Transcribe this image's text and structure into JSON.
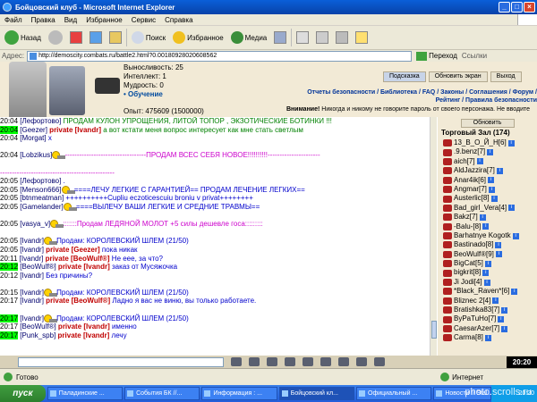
{
  "window": {
    "title": "Бойцовский клуб - Microsoft Internet Explorer"
  },
  "menu": [
    "Файл",
    "Правка",
    "Вид",
    "Избранное",
    "Сервис",
    "Справка"
  ],
  "toolbar": {
    "back": "Назад",
    "search": "Поиск",
    "favorites": "Избранное",
    "media": "Медиа"
  },
  "address": {
    "label": "Адрес:",
    "url": "http://demoscity.combats.ru/battle2.html?0.00180928020608562",
    "go": "Переход",
    "links": "Ссылки"
  },
  "character": {
    "stats": [
      "Выносливость: 25",
      "Интеллект: 1",
      "Мудрость: 0"
    ],
    "training": "• Обучение",
    "exp": "Опыт: 475609 (1500000)"
  },
  "topbuttons": {
    "hint": "Подсказка",
    "refresh": "Обновить экран",
    "exit": "Выход"
  },
  "toplinks": "Отчеты безопасности / Библиотека / FAQ / Законы / Соглашения / Форум / Рейтинг / Правила безопасности",
  "warning": {
    "bold": "Внимание!",
    "text": " Никогда и никому не говорите пароль от своего персонажа. Не вводите"
  },
  "chat": [
    {
      "time": "20:04",
      "hl": false,
      "nick": "[Лефортово]",
      "parts": [
        {
          "c": "green",
          "t": " ПРОДАМ КУЛОН УПРОЩЕНИЯ, ЛИТОЙ ТОПОР , ЭКЗОТИЧЕСКИЕ БОТИНКИ !!!"
        }
      ]
    },
    {
      "time": "20:04",
      "hl": true,
      "nick": "[Geezer]",
      "priv": true,
      "to": "[Ivandr]",
      "parts": [
        {
          "c": "green",
          "t": " а вот кстати меня вопрос интересует как мне стать светлым"
        }
      ]
    },
    {
      "time": "20:04",
      "hl": false,
      "nick": "[Morgat]",
      "parts": [
        {
          "c": "blue",
          "t": " x"
        }
      ]
    },
    {
      "blank": true
    },
    {
      "time": "20:04",
      "hl": false,
      "nick": "[Lobzikus]",
      "smiley": true,
      "parts": [
        {
          "c": "magenta",
          "t": " ----------------------------------ПРОДАМ ВСЕС СЕБЯ НОВОЕ!!!!!!!!!!----------------------"
        }
      ]
    },
    {
      "blank": true
    },
    {
      "time": "",
      "hl": false,
      "nick": "",
      "parts": [
        {
          "c": "magenta",
          "t": "   ------------------------------------------------"
        }
      ]
    },
    {
      "time": "20:05",
      "hl": false,
      "nick": "[Лефортово]",
      "parts": [
        {
          "c": "blue",
          "t": " ."
        }
      ]
    },
    {
      "time": "20:05",
      "hl": false,
      "nick": "[Menson666]",
      "smiley": true,
      "parts": [
        {
          "c": "blue",
          "t": " ====ЛЕЧУ ЛЕГКИЕ С ГАРАНТИЕЙ== ПРОДАМ ЛЕЧЕНИЕ ЛЕГКИХ=="
        }
      ]
    },
    {
      "time": "20:05",
      "hl": false,
      "nick": "[btnmeatman]",
      "parts": [
        {
          "c": "blue",
          "t": " ++++++++++Cupliu eczoticescuiu broniu v privat++++++++"
        }
      ]
    },
    {
      "time": "20:05",
      "hl": false,
      "nick": "[Gamelander]",
      "smiley": true,
      "parts": [
        {
          "c": "blue",
          "t": " ====ВЫЛЕЧУ ВАШИ ЛЕГКИЕ И СРЕДНИЕ ТРАВМЫ=="
        }
      ]
    },
    {
      "blank": true
    },
    {
      "time": "20:05",
      "hl": false,
      "nick": "[vasya_v]",
      "smiley": true,
      "parts": [
        {
          "c": "magenta",
          "t": " :::::::Продам ЛЕДЯНОЙ МОЛОТ +5 силы дешевле госа:::::::::"
        }
      ]
    },
    {
      "blank": true
    },
    {
      "time": "20:05",
      "hl": false,
      "nick": "[Ivandr]",
      "smiley": true,
      "parts": [
        {
          "c": "blue",
          "t": " Продам: КОРОЛЕВСКИЙ ШЛЕМ (21/50)"
        }
      ]
    },
    {
      "time": "20:05",
      "hl": false,
      "nick": "[Ivandr]",
      "priv": true,
      "to": "[Geezer]",
      "parts": [
        {
          "c": "blue",
          "t": " пока никак"
        }
      ]
    },
    {
      "time": "20:11",
      "hl": false,
      "nick": "[Ivandr]",
      "priv": true,
      "to": "[BeoWulf®]",
      "parts": [
        {
          "c": "blue",
          "t": " Не еее, за что?"
        }
      ]
    },
    {
      "time": "20:12",
      "hl": true,
      "nick": "[BeoWulf®]",
      "priv": true,
      "to": "[Ivandr]",
      "parts": [
        {
          "c": "blue",
          "t": " заказ от Мусяжочка"
        }
      ]
    },
    {
      "time": "20:12",
      "hl": false,
      "nick": "[Ivandr]",
      "parts": [
        {
          "c": "blue",
          "t": " Без причины?"
        }
      ]
    },
    {
      "blank": true
    },
    {
      "time": "20:15",
      "hl": false,
      "nick": "[Ivandr]",
      "smiley": true,
      "parts": [
        {
          "c": "blue",
          "t": " Продам: КОРОЛЕВСКИЙ ШЛЕМ (21/50)"
        }
      ]
    },
    {
      "time": "20:17",
      "hl": false,
      "nick": "[Ivandr]",
      "priv": true,
      "to": "[BeoWulf®]",
      "parts": [
        {
          "c": "blue",
          "t": " Ладно я вас не виню, вы только работаете."
        }
      ]
    },
    {
      "blank": true
    },
    {
      "time": "20:17",
      "hl": true,
      "nick": "[Ivandr]",
      "smiley": true,
      "parts": [
        {
          "c": "blue",
          "t": " Продам: КОРОЛЕВСКИЙ ШЛЕМ (21/50)"
        }
      ]
    },
    {
      "time": "20:17",
      "hl": false,
      "nick": "[BeoWulf®]",
      "priv": true,
      "to": "[Ivandr]",
      "parts": [
        {
          "c": "blue",
          "t": " именно"
        }
      ]
    },
    {
      "time": "20:17",
      "hl": true,
      "nick": "[Punk_spb]",
      "priv": true,
      "to": "[Ivandr]",
      "parts": [
        {
          "c": "blue",
          "t": " лечу"
        }
      ]
    }
  ],
  "userlist": {
    "refresh": "Обновить",
    "hall": "Торговый Зал (174)",
    "users": [
      "13_В_О_Й_Н[6]",
      ".9.benz[7]",
      "aich[7]",
      "AldJazzira[7]",
      "Anar4ik[6]",
      "Angmar[7]",
      "Austerlic[8]",
      "Bad_girl_Vera[4]",
      "Bakz[7]",
      "-Balu-[8]",
      "Barhatnye Kogotk",
      "Bastinado[8]",
      "BeoWulf®[9]",
      "BigCat[5]",
      "bigkrit[8]",
      "Ji Jodi[4]",
      "*Black_Raven*[6]",
      "Bliznec 2[4]",
      "Bratishka83[7]",
      "ByPaTuHo[7]",
      "CaesarAzer[7]",
      "Carma[8]"
    ]
  },
  "bottom": {
    "clock": "20:20"
  },
  "status": {
    "left": "Готово",
    "zone": "Интернет"
  },
  "taskbar": {
    "start": "пуск",
    "tasks": [
      "Паладинские ...",
      "События БК //...",
      "Информация : ...",
      "Бойцовский кл...",
      "Официальный ...",
      "Новости // Stal..."
    ],
    "tray": "20:20"
  },
  "watermark": "photo.scrolls.ru",
  "colors": {
    "title": "#0a5fd8",
    "highlight": "#00ff00",
    "priv": "#c00000",
    "nick": "#00006e"
  }
}
